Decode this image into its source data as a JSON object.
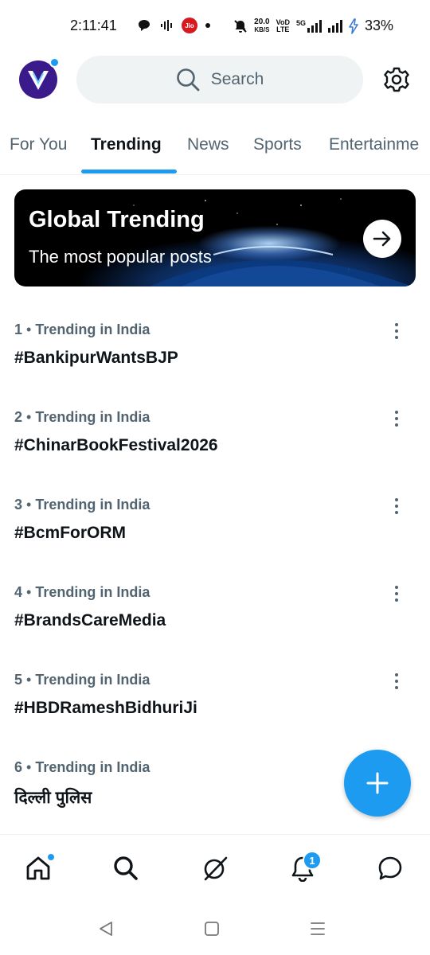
{
  "status_bar": {
    "time": "2:11:41",
    "carrier_badge": "Jio",
    "net_speed_value": "20.0",
    "net_speed_unit": "KB/S",
    "volte_top": "VoD",
    "volte_bottom": "LTE",
    "network_type": "5G",
    "battery": "33%"
  },
  "header": {
    "search_placeholder": "Search",
    "icons": [
      "search-icon",
      "gear-icon"
    ]
  },
  "tabs": [
    {
      "label": "For You",
      "active": false
    },
    {
      "label": "Trending",
      "active": true
    },
    {
      "label": "News",
      "active": false
    },
    {
      "label": "Sports",
      "active": false
    },
    {
      "label": "Entertainme",
      "active": false
    }
  ],
  "banner": {
    "title": "Global Trending",
    "subtitle": "The most popular posts"
  },
  "trending": [
    {
      "rank": "1",
      "context": "Trending in India",
      "tag": "#BankipurWantsBJP"
    },
    {
      "rank": "2",
      "context": "Trending in India",
      "tag": "#ChinarBookFestival2026"
    },
    {
      "rank": "3",
      "context": "Trending in India",
      "tag": "#BcmForORM"
    },
    {
      "rank": "4",
      "context": "Trending in India",
      "tag": "#BrandsCareMedia"
    },
    {
      "rank": "5",
      "context": "Trending in India",
      "tag": "#HBDRameshBidhuriJi"
    },
    {
      "rank": "6",
      "context": "Trending in India",
      "tag": "दिल्ली पुलिस"
    }
  ],
  "bottom_nav": {
    "items": [
      "home-icon",
      "search-icon",
      "grok-icon",
      "notifications-icon",
      "messages-icon"
    ],
    "notification_count": "1"
  },
  "colors": {
    "accent": "#1d9bf0",
    "text_primary": "#0f1419",
    "text_secondary": "#536471",
    "search_bg": "#eff3f4"
  }
}
